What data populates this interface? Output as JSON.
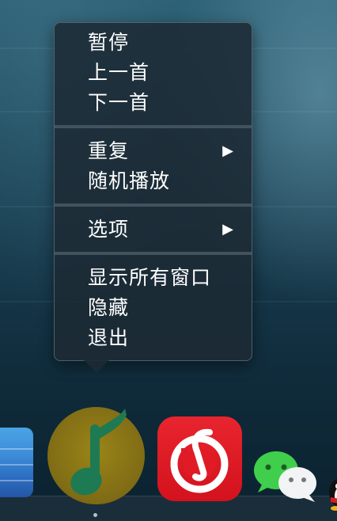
{
  "context_menu": {
    "group1": [
      {
        "label": "暂停"
      },
      {
        "label": "上一首"
      },
      {
        "label": "下一首"
      }
    ],
    "group2": [
      {
        "label": "重复",
        "submenu_arrow": "▶"
      },
      {
        "label": "随机播放"
      }
    ],
    "group3": [
      {
        "label": "选项",
        "submenu_arrow": "▶"
      }
    ],
    "group4": [
      {
        "label": "显示所有窗口"
      },
      {
        "label": "隐藏"
      },
      {
        "label": "退出"
      }
    ]
  },
  "dock": {
    "apps": [
      {
        "name": "blue-app-icon",
        "color": "#3d8cd8"
      },
      {
        "name": "qq-music-icon",
        "color": "#7f6b15",
        "running": true
      },
      {
        "name": "netease-music-icon",
        "color": "#e11b26"
      },
      {
        "name": "wechat-icon",
        "color": "#3fcf4c"
      },
      {
        "name": "qq-icon"
      }
    ]
  },
  "colors": {
    "menu_text": "#ffffff",
    "menu_background": "#1c2a34"
  }
}
